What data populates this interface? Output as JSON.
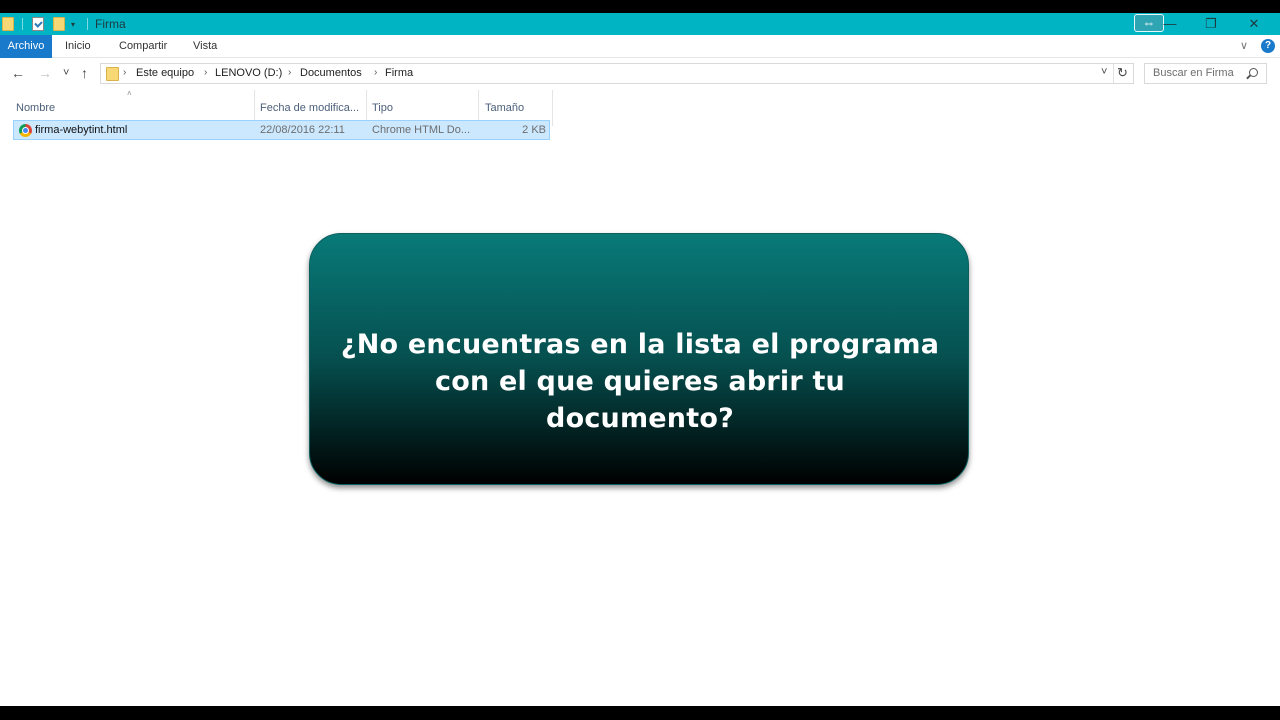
{
  "window": {
    "title": "Firma",
    "resize_icon": "⇔",
    "minimize_icon": "—",
    "restore_icon": "❐",
    "close_icon": "✕"
  },
  "quick_access": {
    "icons": [
      "folder-icon",
      "properties-icon",
      "new-folder-icon",
      "customize-dropdown-icon"
    ]
  },
  "ribbon": {
    "tabs": [
      {
        "label": "Archivo",
        "active": true
      },
      {
        "label": "Inicio"
      },
      {
        "label": "Compartir"
      },
      {
        "label": "Vista"
      }
    ],
    "expand_icon": "∨",
    "help_icon": "?"
  },
  "nav": {
    "back_icon": "←",
    "forward_icon": "→",
    "recent_icon": "˅",
    "up_icon": "↑",
    "breadcrumb": [
      "Este equipo",
      "LENOVO (D:)",
      "Documentos",
      "Firma"
    ],
    "breadcrumb_separator": "›",
    "dropdown_icon": "˅",
    "refresh_icon": "↻",
    "search_placeholder": "Buscar en Firma"
  },
  "columns": {
    "headers": [
      "Nombre",
      "Fecha de modifica...",
      "Tipo",
      "Tamaño"
    ],
    "sort_indicator": "˄"
  },
  "files": [
    {
      "name": "firma-webytint.html",
      "date": "22/08/2016 22:11",
      "type": "Chrome HTML Do...",
      "size": "2 KB",
      "icon": "chrome-icon",
      "selected": true
    }
  ],
  "overlay": {
    "text": "¿No encuentras en la lista el programa con el que quieres abrir tu documento?"
  },
  "colors": {
    "titlebar": "#00b4c4",
    "archivo_tab": "#1979ca",
    "selection": "#cce8ff",
    "overlay_top": "#087a78",
    "overlay_bottom": "#000000"
  }
}
